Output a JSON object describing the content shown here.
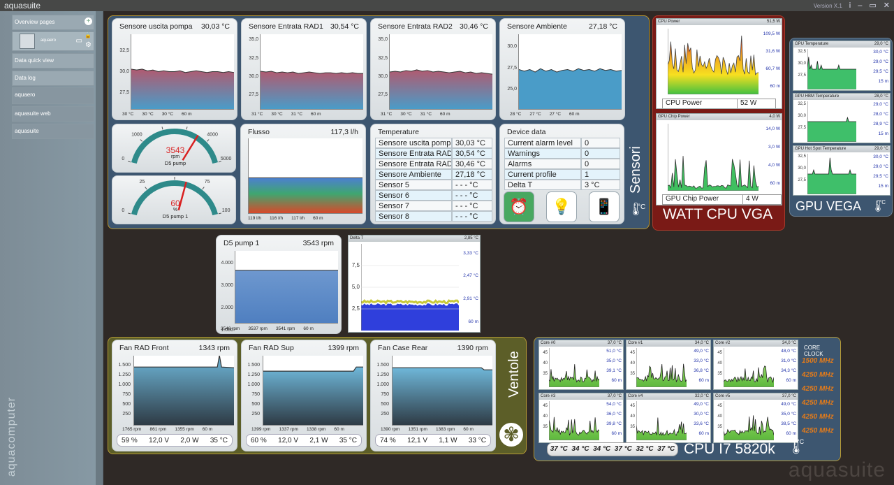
{
  "window": {
    "title": "aquasuite",
    "version": "Version X.1",
    "controls": [
      "i",
      "–",
      "▭",
      "✕"
    ]
  },
  "sidebar": {
    "items": [
      {
        "label": "Overview pages"
      },
      {
        "label": "aquaero"
      },
      {
        "label": "Data quick view"
      },
      {
        "label": "Data log"
      },
      {
        "label": "aquaero"
      },
      {
        "label": "aquasuite web"
      },
      {
        "label": "aquasuite"
      }
    ],
    "brand": "aquacomputer"
  },
  "groups": {
    "sensori": "Sensori",
    "watt": "WATT CPU VGA",
    "gpu": "GPU VEGA",
    "ventole": "Ventole",
    "cpu": "CPU I7 5820k",
    "unit_c": "°C"
  },
  "temp_charts": [
    {
      "title": "Sensore uscita pompa",
      "value": "30,03 °C",
      "ticks": [
        "32,5",
        "30,0",
        "27,5"
      ],
      "stats": [
        "30 °C",
        "30 °C",
        "30 °C",
        "60 m"
      ],
      "data": [
        30.3,
        30.2,
        30.3,
        30.1,
        30.2,
        30.0,
        30.1,
        30.0,
        30.0,
        30.1,
        29.9,
        30.0,
        30.1,
        30.0,
        29.9,
        30.0,
        30.0,
        29.9,
        30.0,
        29.9
      ],
      "ylim": [
        25.5,
        34.5
      ],
      "color": "#b05a70"
    },
    {
      "title": "Sensore Entrata RAD1",
      "value": "30,54 °C",
      "ticks": [
        "35,0",
        "32,5",
        "30,0",
        "27,5"
      ],
      "stats": [
        "31 °C",
        "30 °C",
        "31 °C",
        "60 m"
      ],
      "data": [
        30.7,
        30.6,
        30.7,
        30.5,
        30.6,
        30.5,
        30.6,
        30.4,
        30.5,
        30.6,
        30.5,
        30.4,
        30.5,
        30.5,
        30.4,
        30.5,
        30.4,
        30.5,
        30.4,
        30.4
      ],
      "ylim": [
        25.5,
        35.8
      ],
      "color": "#b05a70"
    },
    {
      "title": "Sensore Entrata RAD2",
      "value": "30,46 °C",
      "ticks": [
        "35,0",
        "32,5",
        "30,0",
        "27,5"
      ],
      "stats": [
        "31 °C",
        "30 °C",
        "31 °C",
        "60 m"
      ],
      "data": [
        30.6,
        30.7,
        30.6,
        30.8,
        30.7,
        30.9,
        30.7,
        30.8,
        30.6,
        30.7,
        30.6,
        30.5,
        30.6,
        30.7,
        30.5,
        30.6,
        30.4,
        30.5,
        30.4,
        30.3
      ],
      "ylim": [
        25.5,
        35.8
      ],
      "color": "#b05a70"
    },
    {
      "title": "Sensore Ambiente",
      "value": "27,18 °C",
      "ticks": [
        "30,0",
        "27,5",
        "25,0"
      ],
      "stats": [
        "28 °C",
        "27 °C",
        "27 °C",
        "60 m"
      ],
      "data": [
        27.3,
        27.1,
        27.3,
        27.0,
        27.4,
        27.1,
        27.3,
        27.0,
        27.2,
        27.3,
        27.1,
        27.4,
        27.2,
        27.3,
        27.1,
        27.4,
        27.2,
        27.3,
        27.1,
        27.2
      ],
      "ylim": [
        22.6,
        31.5
      ],
      "color": "#4a9cc8"
    }
  ],
  "gauges": [
    {
      "value": "3543",
      "unit": "rpm",
      "label": "D5 pump",
      "ticks": [
        "0",
        "1000",
        "2000",
        "3000",
        "4000",
        "5000"
      ],
      "fraction": 0.709
    },
    {
      "value": "60",
      "unit": "%",
      "label": "D5 pump 1",
      "ticks": [
        "0",
        "25",
        "50",
        "75",
        "100"
      ],
      "fraction": 0.6
    }
  ],
  "flusso": {
    "title": "Flusso",
    "value": "117,3 l/h",
    "stats": [
      "119 l/h",
      "116 l/h",
      "117 l/h",
      "60 m"
    ]
  },
  "temperature_table": {
    "title": "Temperature",
    "rows": [
      {
        "name": "Sensore uscita pompa",
        "value": "30,03 °C"
      },
      {
        "name": "Sensore Entrata RAD1",
        "value": "30,54 °C"
      },
      {
        "name": "Sensore Entrata RAD2",
        "value": "30,46 °C"
      },
      {
        "name": "Sensore Ambiente",
        "value": "27,18 °C"
      },
      {
        "name": "Sensor 5",
        "value": "- - - °C"
      },
      {
        "name": "Sensor 6",
        "value": "- - - °C"
      },
      {
        "name": "Sensor 7",
        "value": "- - - °C"
      },
      {
        "name": "Sensor 8",
        "value": "- - - °C"
      }
    ]
  },
  "device_table": {
    "title": "Device data",
    "rows": [
      {
        "name": "Current alarm level",
        "value": "0"
      },
      {
        "name": "Warnings",
        "value": "0"
      },
      {
        "name": "Alarms",
        "value": "0"
      },
      {
        "name": "Current profile",
        "value": "1"
      },
      {
        "name": "Delta T",
        "value": "3 °C"
      }
    ],
    "icons": [
      "alarm-icon",
      "lightbulb-icon",
      "phone-icon"
    ]
  },
  "watt": [
    {
      "title": "CPU Power",
      "max": "51,5 W",
      "legend": [
        "109,5 W",
        "31,6 W",
        "60,7 W",
        "60 m"
      ],
      "label": "CPU Power",
      "value": "52 W"
    },
    {
      "title": "GPU Chip Power",
      "max": "4,0 W",
      "legend": [
        "14,0 W",
        "3,0 W",
        "4,0 W",
        "60 m"
      ],
      "label": "GPU Chip Power",
      "value": "4 W"
    }
  ],
  "gpu": [
    {
      "title": "GPU Temperature",
      "max": "29,0 °C",
      "ticks": [
        "32,5",
        "30,0",
        "27,5"
      ],
      "legend": [
        "30,0 °C",
        "29,0 °C",
        "29,5 °C",
        "15 m"
      ]
    },
    {
      "title": "GPU HBM Temperature",
      "max": "28,0 °C",
      "ticks": [
        "32,5",
        "30,0",
        "27,5"
      ],
      "legend": [
        "29,0 °C",
        "28,0 °C",
        "28,9 °C",
        "15 m"
      ]
    },
    {
      "title": "GPU Hot Spot Temperature",
      "max": "29,0 °C",
      "ticks": [
        "32,5",
        "30,0",
        "27,5"
      ],
      "legend": [
        "30,0 °C",
        "29,0 °C",
        "29,5 °C",
        "15 m"
      ]
    }
  ],
  "d5": {
    "title": "D5 pump 1",
    "value": "3543 rpm",
    "ticks": [
      "4.000",
      "3.000",
      "2.000",
      "1.000"
    ],
    "stats": [
      "3548 rpm",
      "3537 rpm",
      "3541 rpm",
      "60 m"
    ]
  },
  "delta": {
    "title": "Delta T",
    "max": "2,85 °C",
    "ticks": [
      "7,5",
      "5,0",
      "2,5"
    ],
    "legend": [
      "3,33 °C",
      "2,47 °C",
      "2,91 °C",
      "60 m"
    ]
  },
  "fans": [
    {
      "title": "Fan RAD Front",
      "value": "1343 rpm",
      "ticks": [
        "1.500",
        "1.250",
        "1.000",
        "750",
        "500",
        "250"
      ],
      "stats": [
        "1765 rpm",
        "861 rpm",
        "1355 rpm",
        "60 m"
      ],
      "pct": "59 %",
      "volt": "12,0 V",
      "watt": "2,0 W",
      "temp": "35 °C"
    },
    {
      "title": "Fan RAD Sup",
      "value": "1399 rpm",
      "ticks": [
        "1.500",
        "1.250",
        "1.000",
        "750",
        "500",
        "250"
      ],
      "stats": [
        "1399 rpm",
        "1337 rpm",
        "1338 rpm",
        "60 m"
      ],
      "pct": "60 %",
      "volt": "12,0 V",
      "watt": "2,1 W",
      "temp": "35 °C"
    },
    {
      "title": "Fan Case Rear",
      "value": "1390 rpm",
      "ticks": [
        "1.500",
        "1.250",
        "1.000",
        "750",
        "500",
        "250"
      ],
      "stats": [
        "1390 rpm",
        "1351 rpm",
        "1383 rpm",
        "60 m"
      ],
      "pct": "74 %",
      "volt": "12,1 V",
      "watt": "1,1 W",
      "temp": "33 °C"
    }
  ],
  "cores": [
    {
      "title": "Core #0",
      "max": "37,0 °C",
      "legend": [
        "51,0 °C",
        "35,0 °C",
        "39,1 °C",
        "60 m"
      ]
    },
    {
      "title": "Core #1",
      "max": "34,0 °C",
      "legend": [
        "49,0 °C",
        "33,0 °C",
        "36,8 °C",
        "60 m"
      ]
    },
    {
      "title": "Core #2",
      "max": "34,0 °C",
      "legend": [
        "48,0 °C",
        "31,0 °C",
        "34,3 °C",
        "60 m"
      ]
    },
    {
      "title": "Core #3",
      "max": "37,0 °C",
      "legend": [
        "54,0 °C",
        "36,0 °C",
        "39,8 °C",
        "60 m"
      ]
    },
    {
      "title": "Core #4",
      "max": "32,0 °C",
      "legend": [
        "49,0 °C",
        "30,0 °C",
        "33,6 °C",
        "60 m"
      ]
    },
    {
      "title": "Core #5",
      "max": "37,0 °C",
      "legend": [
        "49,0 °C",
        "35,0 °C",
        "38,5 °C",
        "60 m"
      ]
    }
  ],
  "core_ticks": [
    "45",
    "40",
    "35"
  ],
  "core_temps": "37 °C  34 °C  34 °C  37 °C  32 °C  37 °C",
  "core_clock": {
    "title": "CORE CLOCK",
    "values": [
      "1500 MHz",
      "4250 MHz",
      "4250 MHz",
      "4250 MHz",
      "4250 MHz",
      "4250 MHz"
    ]
  },
  "watermark": "aquasuite"
}
